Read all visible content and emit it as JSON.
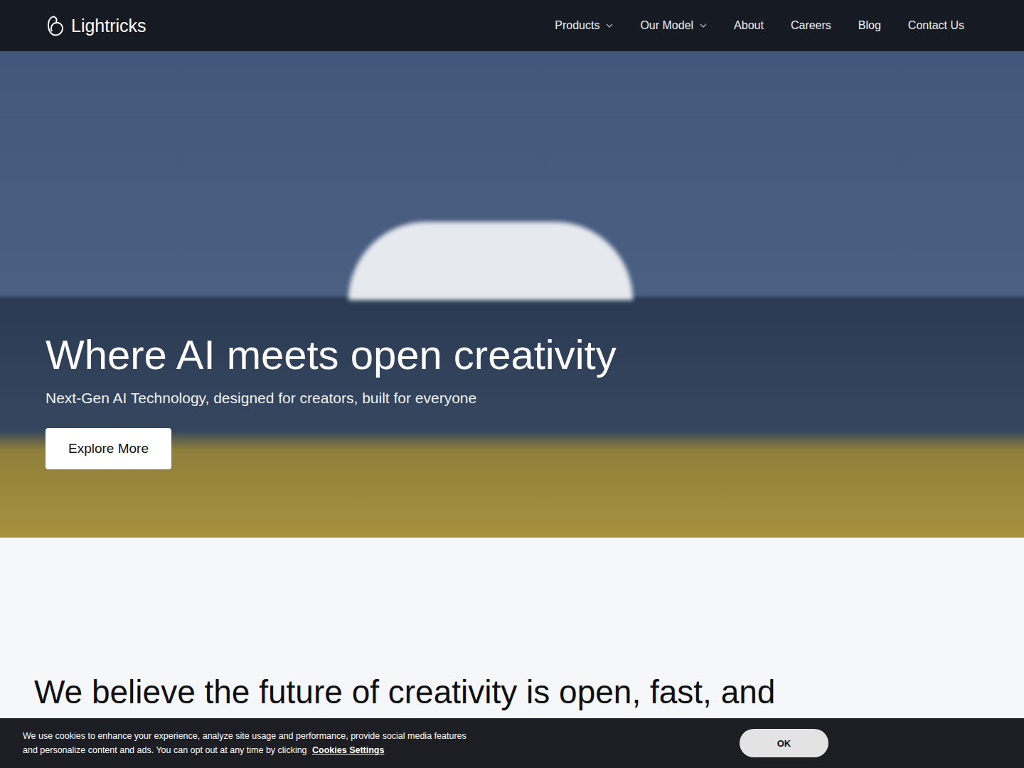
{
  "header": {
    "logo": "Lightricks",
    "nav": [
      {
        "label": "Products",
        "dropdown": true
      },
      {
        "label": "Our Model",
        "dropdown": true
      },
      {
        "label": "About",
        "dropdown": false
      },
      {
        "label": "Careers",
        "dropdown": false
      },
      {
        "label": "Blog",
        "dropdown": false
      },
      {
        "label": "Contact Us",
        "dropdown": false
      }
    ]
  },
  "hero": {
    "title": "Where AI meets open creativity",
    "subtitle": "Next-Gen AI Technology, designed for creators, built for everyone",
    "button": "Explore More"
  },
  "section": {
    "heading": "We believe the future of creativity is open, fast, and"
  },
  "cookie_banner": {
    "text": "We use cookies to enhance your experience, analyze site usage and performance, provide social media features and personalize content and ads. You can opt out at any time by clicking",
    "link": "Cookies Settings",
    "button": "OK"
  }
}
